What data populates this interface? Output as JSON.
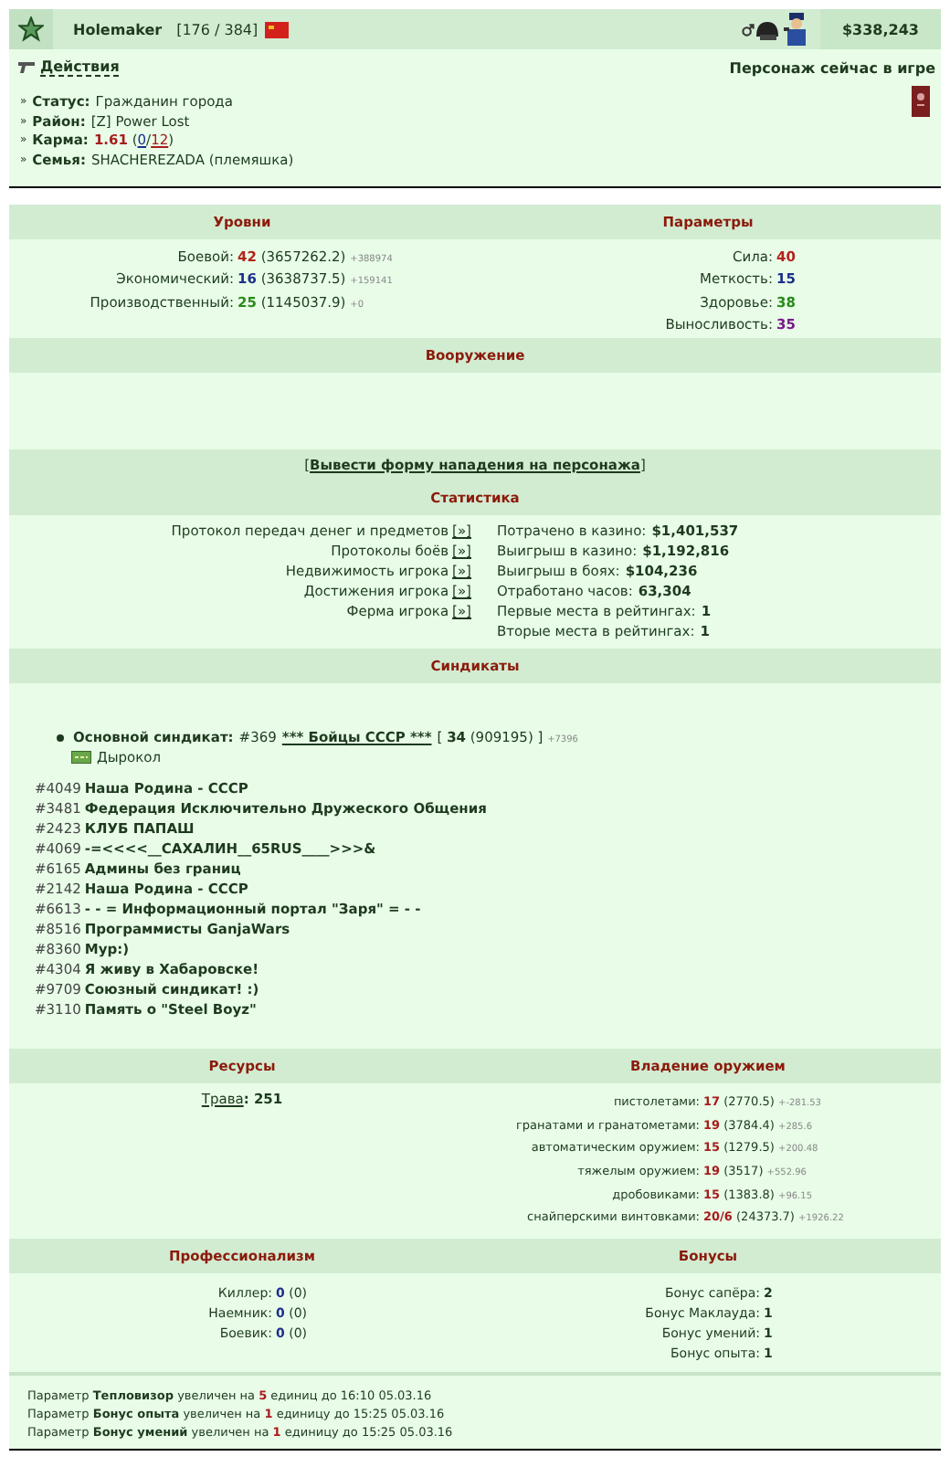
{
  "header": {
    "name": "Holemaker",
    "level": "[176 / 384]",
    "money": "$338,243"
  },
  "actions_link": "Действия",
  "online_status": "Персонаж сейчас в игре",
  "info": [
    {
      "kind": "text",
      "bullet": "»",
      "label": "Статус:",
      "value": "Гражданин города"
    },
    {
      "kind": "text",
      "bullet": "»",
      "label": "Район:",
      "value": "[Z] Power Lost"
    },
    {
      "kind": "karma",
      "bullet": "»",
      "label": "Карма:",
      "value": "1.61",
      "open": "(",
      "plus": "0",
      "sep": "/",
      "minus": "12",
      "close": ")"
    },
    {
      "kind": "text",
      "bullet": "»",
      "label": "Семья:",
      "value": "SHACHEREZADA (племяшка)"
    }
  ],
  "levels_title": "Уровни",
  "params_title": "Параметры",
  "levels": [
    {
      "label": "Боевой:",
      "value": "42",
      "color": "#b3231b",
      "exp": "(3657262.2)",
      "delta": "+388974"
    },
    {
      "label": "Экономический:",
      "value": "16",
      "color": "#1a2f8a",
      "exp": "(3638737.5)",
      "delta": "+159141"
    },
    {
      "label": "Производственный:",
      "value": "25",
      "color": "#2a8a1a",
      "exp": "(1145037.9)",
      "delta": "+0"
    }
  ],
  "params": [
    {
      "label": "Сила:",
      "value": "40",
      "color": "#b3231b"
    },
    {
      "label": "Меткость:",
      "value": "15",
      "color": "#1a2f8a"
    },
    {
      "label": "Здоровье:",
      "value": "38",
      "color": "#2a8a1a"
    },
    {
      "label": "Выносливость:",
      "value": "35",
      "color": "#7a1a8a"
    }
  ],
  "armament_title": "Вооружение",
  "attack": {
    "open": "[",
    "link": "Вывести форму нападения на персонажа",
    "close": "]"
  },
  "stats_title": "Статистика",
  "stat_links": [
    {
      "label": "Протокол передач денег и предметов",
      "button": "[»]"
    },
    {
      "label": "Протоколы боёв",
      "button": "[»]"
    },
    {
      "label": "Недвижимость игрока",
      "button": "[»]"
    },
    {
      "label": "Достижения игрока",
      "button": "[»]"
    },
    {
      "label": "Ферма игрока",
      "button": "[»]"
    }
  ],
  "stat_values": [
    {
      "label": "Потрачено в казино:",
      "value": "$1,401,537"
    },
    {
      "label": "Выигрыш в казино:",
      "value": "$1,192,816"
    },
    {
      "label": "Выигрыш в боях:",
      "value": "$104,236"
    },
    {
      "label": "Отработано часов:",
      "value": "63,304"
    },
    {
      "label": "Первые места в рейтингах:",
      "value": "1"
    },
    {
      "label": "Вторые места в рейтингах:",
      "value": "1"
    }
  ],
  "syndicates_title": "Синдикаты",
  "main_syndicate": {
    "label": "Основной синдикат:",
    "number": "#369",
    "name": "*** Бойцы СССР ***",
    "open": "[",
    "level": "34",
    "exp": "(909195)",
    "close": "]",
    "delta": "+7396",
    "rank": "Дырокол"
  },
  "syndicates": [
    {
      "number": "#4049",
      "name": "Наша Родина - СССР"
    },
    {
      "number": "#3481",
      "name": "Федерация Исключительно Дружеского Общения"
    },
    {
      "number": "#2423",
      "name": "КЛУБ ПАПАШ"
    },
    {
      "number": "#4069",
      "name": "-=<<<<__САХАЛИН__65RUS____>>>&"
    },
    {
      "number": "#6165",
      "name": "Админы без границ"
    },
    {
      "number": "#2142",
      "name": "Наша Родина - СССР"
    },
    {
      "number": "#6613",
      "name": "- - = Информационный портал \"Заря\" = - -"
    },
    {
      "number": "#8516",
      "name": "Программисты GanjaWars"
    },
    {
      "number": "#8360",
      "name": "Мур:)"
    },
    {
      "number": "#4304",
      "name": "Я живу в Хабаровске!"
    },
    {
      "number": "#9709",
      "name": "Союзный синдикат! :)"
    },
    {
      "number": "#3110",
      "name": "Память о \"Steel Boyz\""
    }
  ],
  "resources_title": "Ресурсы",
  "weapons_title": "Владение оружием",
  "resources": [
    {
      "name": "Трава",
      "value": ": 251"
    }
  ],
  "weapons": [
    {
      "label": "пистолетами:",
      "value": "17",
      "exp": "(2770.5)",
      "delta": "+-281.53"
    },
    {
      "label": "гранатами и гранатометами:",
      "value": "19",
      "exp": "(3784.4)",
      "delta": "+285.6"
    },
    {
      "label": "автоматическим оружием:",
      "value": "15",
      "exp": "(1279.5)",
      "delta": "+200.48"
    },
    {
      "label": "тяжелым оружием:",
      "value": "19",
      "exp": "(3517)",
      "delta": "+552.96"
    },
    {
      "label": "дробовиками:",
      "value": "15",
      "exp": "(1383.8)",
      "delta": "+96.15"
    },
    {
      "label": "снайперскими винтовками:",
      "value": "20/6",
      "exp": "(24373.7)",
      "delta": "+1926.22"
    }
  ],
  "profession_title": "Профессионализм",
  "bonuses_title": "Бонусы",
  "professions": [
    {
      "label": "Киллер:",
      "value": "0",
      "exp": "(0)"
    },
    {
      "label": "Наемник:",
      "value": "0",
      "exp": "(0)"
    },
    {
      "label": "Боевик:",
      "value": "0",
      "exp": "(0)"
    }
  ],
  "bonuses": [
    {
      "label": "Бонус сапёра:",
      "value": "2"
    },
    {
      "label": "Бонус Маклауда:",
      "value": "1"
    },
    {
      "label": "Бонус умений:",
      "value": "1"
    },
    {
      "label": "Бонус опыта:",
      "value": "1"
    }
  ],
  "notices": [
    {
      "before": "Параметр",
      "param": "Тепловизор",
      "mid": "увеличен на",
      "amount": "5",
      "after": "единиц до 16:10 05.03.16"
    },
    {
      "before": "Параметр",
      "param": "Бонус опыта",
      "mid": "увеличен на",
      "amount": "1",
      "after": "единицу до 15:25 05.03.16"
    },
    {
      "before": "Параметр",
      "param": "Бонус умений",
      "mid": "увеличен на",
      "amount": "1",
      "after": "единицу до 15:25 05.03.16"
    }
  ]
}
